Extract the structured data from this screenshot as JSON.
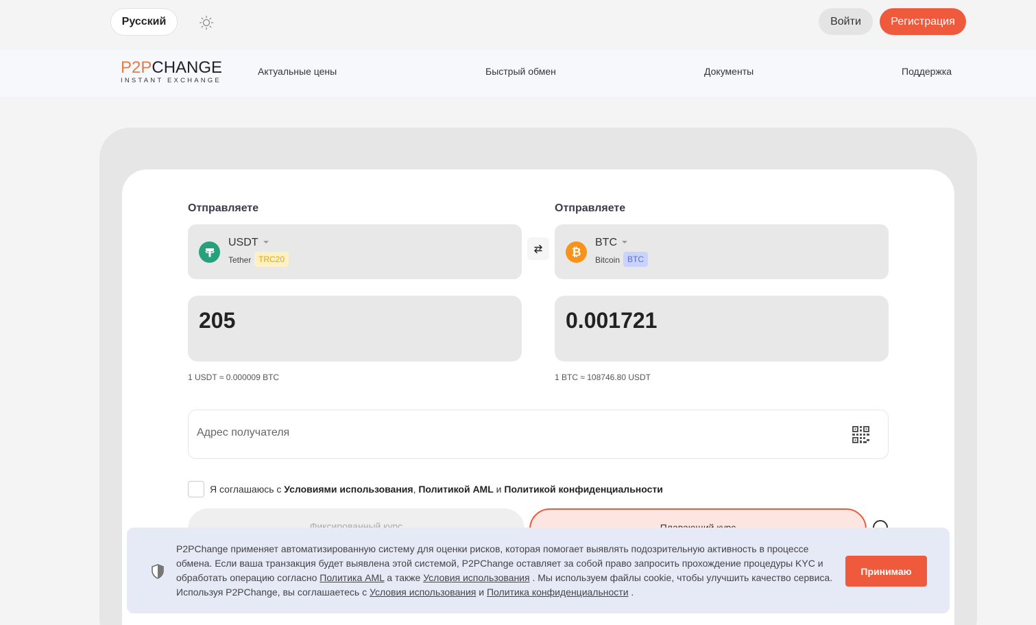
{
  "header": {
    "language": "Русский",
    "login": "Войти",
    "register": "Регистрация"
  },
  "logo": {
    "part1": "P2P",
    "part2": "CHANGE",
    "tagline": "INSTANT EXCHANGE"
  },
  "nav": {
    "items": [
      "Актуальные цены",
      "Быстрый обмен",
      "Документы",
      "Поддержка"
    ]
  },
  "exchange": {
    "left": {
      "label": "Отправляете",
      "code": "USDT",
      "name": "Tether",
      "network": "TRC20",
      "amount": "205",
      "rate": "1 USDT ≈ 0.000009 BTC",
      "color": "#26a17b"
    },
    "right": {
      "label": "Отправляете",
      "code": "BTC",
      "name": "Bitcoin",
      "network": "BTC",
      "amount": "0.001721",
      "rate": "1 BTC ≈ 108746.80 USDT",
      "color": "#f7931a"
    },
    "address_placeholder": "Адрес получателя",
    "agree": {
      "prefix": "Я соглашаюсь с",
      "terms": "Условиями использования",
      "comma": ",",
      "aml": "Политикой AML",
      "and": "и",
      "privacy": "Политикой конфиденциальности"
    },
    "tabs": {
      "fixed": "Фиксированный курс",
      "floating": "Плавающий курс"
    }
  },
  "cookie": {
    "text1": "P2PChange применяет автоматизированную систему для оценки рисков, которая помогает выявлять подозрительную активность в процессе обмена. Если ваша транзакция будет выявлена этой системой, P2PChange оставляет за собой право запросить прохождение процедуры KYC и обработать операцию согласно",
    "link_aml": "Политика AML",
    "text2": "а также",
    "link_terms": "Условия использования",
    "text3": ". Мы используем файлы cookie, чтобы улучшить качество сервиса. Используя P2PChange, вы соглашаетесь с",
    "link_terms2": "Условия использования",
    "text4": "и",
    "link_privacy": "Политика конфиденциальности",
    "text5": ".",
    "accept": "Принимаю"
  },
  "colors": {
    "accent": "#f05a3c",
    "trc20_badge_bg": "#fdf0c4",
    "trc20_badge_text": "#e8a800",
    "btc_badge_bg": "#c9d3fb",
    "btc_badge_text": "#5a6fd8"
  }
}
